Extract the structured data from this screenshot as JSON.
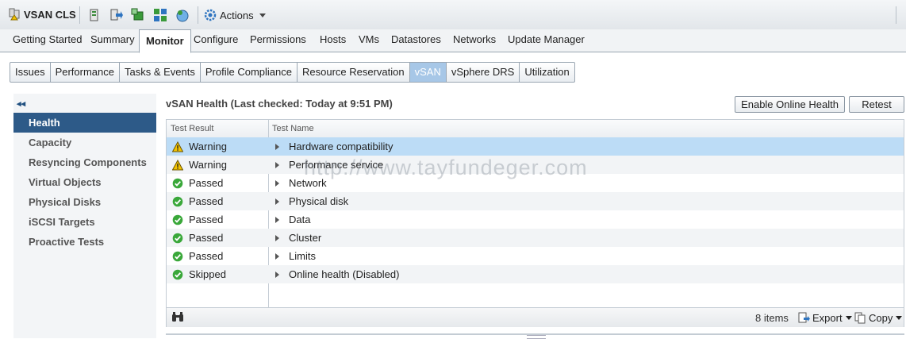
{
  "header": {
    "object_title": "VSAN CLS",
    "actions_label": "Actions"
  },
  "main_tabs": [
    "Getting Started",
    "Summary",
    "Monitor",
    "Configure",
    "Permissions",
    "Hosts",
    "VMs",
    "Datastores",
    "Networks",
    "Update Manager"
  ],
  "main_tab_active": "Monitor",
  "sub_tabs": [
    "Issues",
    "Performance",
    "Tasks & Events",
    "Profile Compliance",
    "Resource Reservation",
    "vSAN",
    "vSphere DRS",
    "Utilization"
  ],
  "sub_tab_active": "vSAN",
  "left_nav": {
    "collapse_symbol": "◂◂",
    "items": [
      "Health",
      "Capacity",
      "Resyncing Components",
      "Virtual Objects",
      "Physical Disks",
      "iSCSI Targets",
      "Proactive Tests"
    ],
    "active": "Health"
  },
  "health": {
    "title": "vSAN Health (Last checked: Today at 9:51 PM)",
    "enable_online_label": "Enable Online Health",
    "retest_label": "Retest"
  },
  "grid": {
    "columns": [
      "Test Result",
      "Test Name"
    ],
    "rows": [
      {
        "status": "Warning",
        "icon": "warning-icon",
        "name": "Hardware compatibility"
      },
      {
        "status": "Warning",
        "icon": "warning-icon",
        "name": "Performance service"
      },
      {
        "status": "Passed",
        "icon": "check-icon",
        "name": "Network"
      },
      {
        "status": "Passed",
        "icon": "check-icon",
        "name": "Physical disk"
      },
      {
        "status": "Passed",
        "icon": "check-icon",
        "name": "Data"
      },
      {
        "status": "Passed",
        "icon": "check-icon",
        "name": "Cluster"
      },
      {
        "status": "Passed",
        "icon": "check-icon",
        "name": "Limits"
      },
      {
        "status": "Skipped",
        "icon": "check-icon",
        "name": "Online health (Disabled)"
      }
    ],
    "selected_row": 0,
    "items_count": "8 items",
    "export_label": "Export",
    "copy_label": "Copy"
  },
  "watermark": "http://www.tayfundeger.com",
  "colors": {
    "active_nav": "#2d5a88",
    "selected_row": "#bcdcf6",
    "active_subtab": "#a7c7e7",
    "warning": "#f2c200",
    "passed": "#3aa83a"
  }
}
